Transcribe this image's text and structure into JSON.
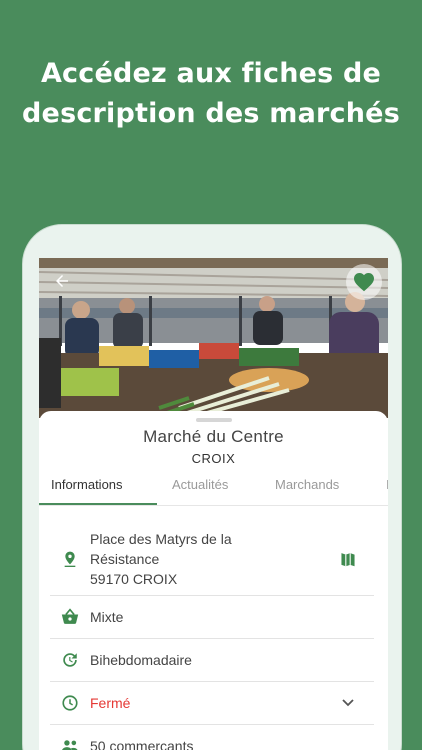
{
  "headline": {
    "line1": "Accédez aux fiches de",
    "line2": "description des marchés"
  },
  "market": {
    "name": "Marché du Centre",
    "city": "CROIX"
  },
  "tabs": [
    {
      "label": "Informations",
      "active": true
    },
    {
      "label": "Actualités",
      "active": false
    },
    {
      "label": "Marchands",
      "active": false
    },
    {
      "label": "I",
      "active": false
    }
  ],
  "info": {
    "address": {
      "line1": "Place des Matyrs de la",
      "line2": "Résistance",
      "line3": "59170 CROIX",
      "icon": "location-pin-icon",
      "action_icon": "map-icon"
    },
    "type": {
      "label": "Mixte",
      "icon": "basket-icon"
    },
    "frequency": {
      "label": "Bihebdomadaire",
      "icon": "refresh-clock-icon"
    },
    "status": {
      "label": "Fermé",
      "icon": "clock-icon",
      "color": "#e53935"
    },
    "merchants": {
      "label": "50 commerçants",
      "icon": "people-icon"
    }
  },
  "colors": {
    "brand_green": "#4a8c5c",
    "closed_red": "#e53935"
  }
}
